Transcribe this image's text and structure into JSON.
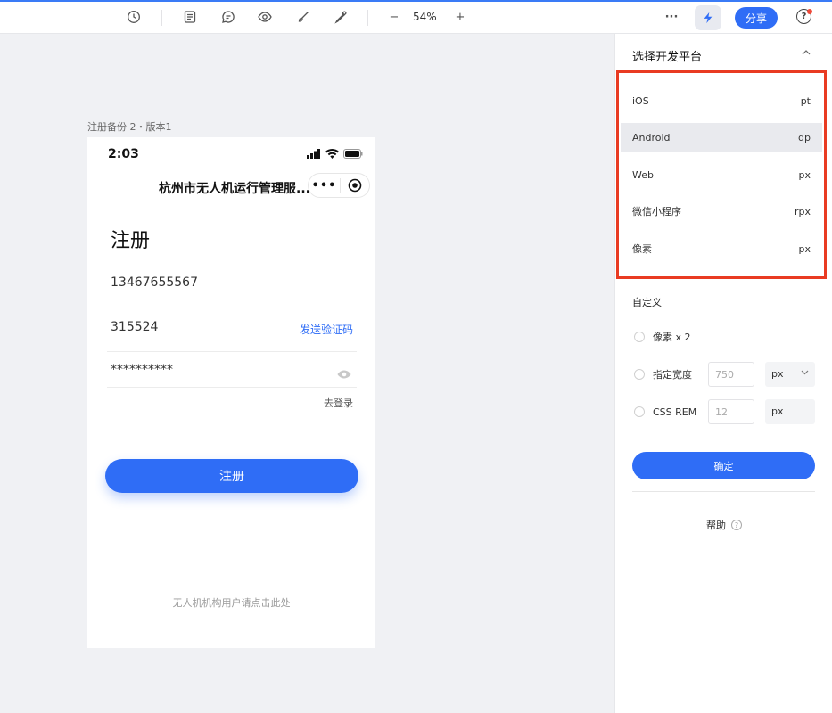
{
  "toolbar": {
    "zoom": "54%",
    "zoom_minus": "−",
    "zoom_plus": "+",
    "more": "···",
    "share_label": "分享",
    "help": "?",
    "accent_color": "#2f6df6",
    "icons": [
      "history-icon",
      "notes-icon",
      "comment-icon",
      "eye-icon",
      "brush-icon",
      "eyedropper-icon",
      "bolt-icon"
    ]
  },
  "artboard": {
    "label": "注册备份 2・版本1",
    "status_time": "2:03",
    "app_title": "杭州市无人机运行管理服...",
    "capsule_dots": "•••",
    "heading": "注册",
    "phone_value": "13467655567",
    "code_value": "315524",
    "send_code": "发送验证码",
    "password_value": "**********",
    "to_login": "去登录",
    "register_button": "注册",
    "org_link": "无人机机构用户请点击此处"
  },
  "panel": {
    "title": "选择开发平台",
    "platforms": [
      {
        "name": "iOS",
        "unit": "pt"
      },
      {
        "name": "Android",
        "unit": "dp"
      },
      {
        "name": "Web",
        "unit": "px"
      },
      {
        "name": "微信小程序",
        "unit": "rpx"
      },
      {
        "name": "像素",
        "unit": "px"
      }
    ],
    "selected_platform": "Android",
    "custom_title": "自定义",
    "custom_pixel": "像素 x 2",
    "custom_width_label": "指定宽度",
    "custom_width_placeholder": "750",
    "custom_width_unit": "px",
    "css_rem_label": "CSS REM",
    "css_rem_placeholder": "12",
    "css_rem_unit": "px",
    "confirm": "确定",
    "help": "帮助",
    "help_q": "?",
    "highlight_color": "#e93b22"
  }
}
